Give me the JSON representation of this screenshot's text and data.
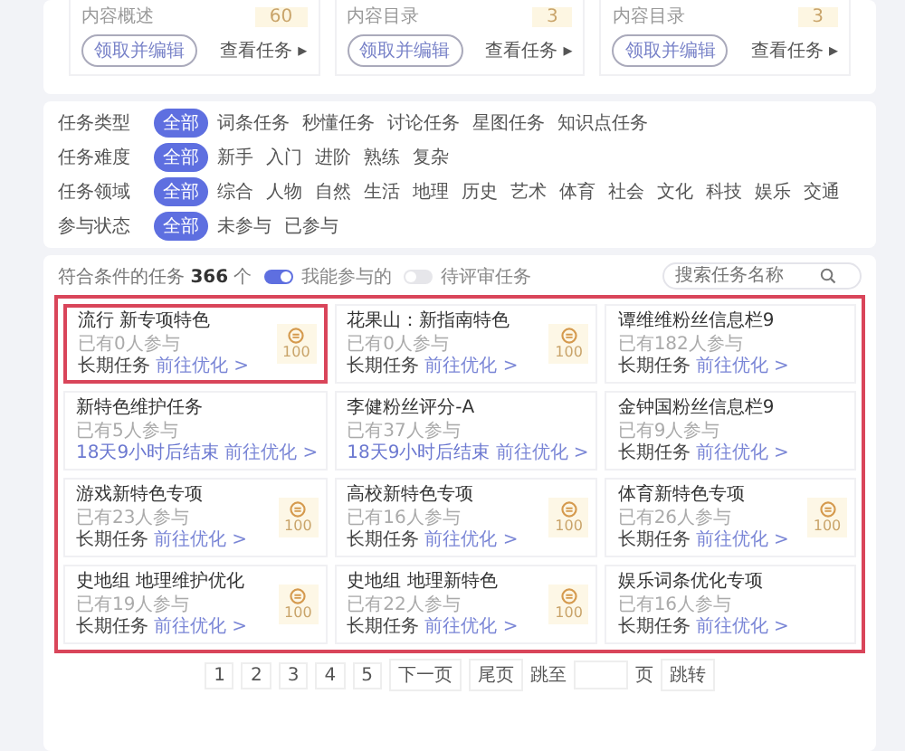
{
  "top_cards": [
    {
      "summary": "内容概述",
      "count": "60",
      "claim_button": "领取并编辑",
      "view_link": "查看任务 ▸"
    },
    {
      "summary": "内容目录",
      "count": "3",
      "claim_button": "领取并编辑",
      "view_link": "查看任务 ▸"
    },
    {
      "summary": "内容目录",
      "count": "3",
      "claim_button": "领取并编辑",
      "view_link": "查看任务 ▸"
    }
  ],
  "filters": [
    {
      "label": "任务类型",
      "options": [
        {
          "text": "全部",
          "selected": true
        },
        {
          "text": "词条任务",
          "selected": false
        },
        {
          "text": "秒懂任务",
          "selected": false
        },
        {
          "text": "讨论任务",
          "selected": false
        },
        {
          "text": "星图任务",
          "selected": false
        },
        {
          "text": "知识点任务",
          "selected": false
        }
      ]
    },
    {
      "label": "任务难度",
      "options": [
        {
          "text": "全部",
          "selected": true
        },
        {
          "text": "新手",
          "selected": false
        },
        {
          "text": "入门",
          "selected": false
        },
        {
          "text": "进阶",
          "selected": false
        },
        {
          "text": "熟练",
          "selected": false
        },
        {
          "text": "复杂",
          "selected": false
        }
      ]
    },
    {
      "label": "任务领域",
      "options": [
        {
          "text": "全部",
          "selected": true
        },
        {
          "text": "综合",
          "selected": false
        },
        {
          "text": "人物",
          "selected": false
        },
        {
          "text": "自然",
          "selected": false
        },
        {
          "text": "生活",
          "selected": false
        },
        {
          "text": "地理",
          "selected": false
        },
        {
          "text": "历史",
          "selected": false
        },
        {
          "text": "艺术",
          "selected": false
        },
        {
          "text": "体育",
          "selected": false
        },
        {
          "text": "社会",
          "selected": false
        },
        {
          "text": "文化",
          "selected": false
        },
        {
          "text": "科技",
          "selected": false
        },
        {
          "text": "娱乐",
          "selected": false
        },
        {
          "text": "交通",
          "selected": false
        }
      ]
    },
    {
      "label": "参与状态",
      "options": [
        {
          "text": "全部",
          "selected": true
        },
        {
          "text": "未参与",
          "selected": false
        },
        {
          "text": "已参与",
          "selected": false
        }
      ]
    }
  ],
  "list_header": {
    "result_label": "符合条件的任务",
    "result_count": "366",
    "result_unit": "个",
    "toggles": [
      {
        "label": "我能参与的",
        "on": true
      },
      {
        "label": "待评审任务",
        "on": false
      }
    ],
    "search": {
      "placeholder": "搜索任务名称"
    }
  },
  "task_list": {
    "outlined": true,
    "tasks": [
      {
        "title": "流行 新专项特色",
        "participants": "已有0人参与",
        "deadline": "长期任务",
        "kind": "long-term",
        "action": "前往优化 >",
        "reward": "100",
        "outlined": true
      },
      {
        "title": "花果山：新指南特色",
        "participants": "已有0人参与",
        "deadline": "长期任务",
        "kind": "long-term",
        "action": "前往优化 >",
        "reward": "100",
        "outlined": false
      },
      {
        "title": "谭维维粉丝信息栏9",
        "participants": "已有182人参与",
        "deadline": "长期任务",
        "kind": "long-term",
        "action": "前往优化 >",
        "outlined": false
      },
      {
        "title": "新特色维护任务",
        "participants": "已有5人参与",
        "deadline": "18天9小时后结束",
        "kind": "countdown",
        "action": "前往优化 >",
        "outlined": false
      },
      {
        "title": "李健粉丝评分-A",
        "participants": "已有37人参与",
        "deadline": "18天9小时后结束",
        "kind": "countdown",
        "action": "前往优化 >",
        "outlined": false
      },
      {
        "title": "金钟国粉丝信息栏9",
        "participants": "已有9人参与",
        "deadline": "长期任务",
        "kind": "long-term",
        "action": "前往优化 >",
        "outlined": false
      },
      {
        "title": "游戏新特色专项",
        "participants": "已有23人参与",
        "deadline": "长期任务",
        "kind": "long-term",
        "action": "前往优化 >",
        "reward": "100",
        "outlined": false
      },
      {
        "title": "高校新特色专项",
        "participants": "已有16人参与",
        "deadline": "长期任务",
        "kind": "long-term",
        "action": "前往优化 >",
        "reward": "100",
        "outlined": false
      },
      {
        "title": "体育新特色专项",
        "participants": "已有26人参与",
        "deadline": "长期任务",
        "kind": "long-term",
        "action": "前往优化 >",
        "reward": "100",
        "outlined": false
      },
      {
        "title": "史地组 地理维护优化",
        "participants": "已有19人参与",
        "deadline": "长期任务",
        "kind": "long-term",
        "action": "前往优化 >",
        "reward": "100",
        "outlined": false
      },
      {
        "title": "史地组 地理新特色",
        "participants": "已有22人参与",
        "deadline": "长期任务",
        "kind": "long-term",
        "action": "前往优化 >",
        "reward": "100",
        "outlined": false
      },
      {
        "title": "娱乐词条优化专项",
        "participants": "已有16人参与",
        "deadline": "长期任务",
        "kind": "long-term",
        "action": "前往优化 >",
        "outlined": false
      }
    ]
  },
  "pagination": {
    "pages": [
      "1",
      "2",
      "3",
      "4",
      "5"
    ],
    "next": "下一页",
    "last": "尾页",
    "jump_label": "跳至",
    "page_unit": "页",
    "jump_button": "跳转"
  }
}
